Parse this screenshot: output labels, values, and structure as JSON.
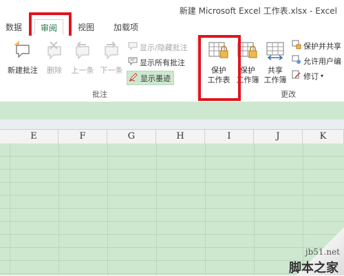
{
  "window": {
    "title": "新建 Microsoft Excel 工作表.xlsx - Excel"
  },
  "tabs": [
    {
      "label": "数据"
    },
    {
      "label": "审阅"
    },
    {
      "label": "视图"
    },
    {
      "label": "加载项"
    }
  ],
  "ribbon": {
    "comments_group": {
      "label": "批注",
      "new_comment": "新建批注",
      "delete": "删除",
      "previous": "上一条",
      "next": "下一条",
      "show_hide": "显示/隐藏批注",
      "show_all": "显示所有批注",
      "show_ink": "显示墨迹"
    },
    "changes_group": {
      "label": "更改",
      "protect_sheet_line1": "保护",
      "protect_sheet_line2": "工作表",
      "protect_workbook_line1": "保护",
      "protect_workbook_line2": "工作簿",
      "share_line1": "共享",
      "share_line2": "工作簿",
      "protect_share": "保护并共享",
      "allow_edit": "允许用户编",
      "track_changes": "修订"
    }
  },
  "columns": [
    "E",
    "F",
    "G",
    "H",
    "I",
    "J",
    "K"
  ],
  "watermark": {
    "line1": "jb51.net",
    "line2": "脚本之家"
  },
  "colors": {
    "accent": "#217346",
    "highlight": "#e0141e",
    "sheet_bg": "#cde8cf"
  }
}
